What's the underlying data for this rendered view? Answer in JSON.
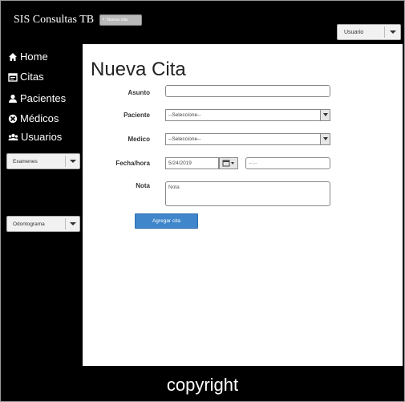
{
  "header": {
    "app_title": "SIS Consultas TB",
    "breadcrumb": "Nueva cita",
    "user_menu": "Usuario"
  },
  "sidebar": {
    "items": [
      {
        "label": "Home",
        "icon": "home-icon"
      },
      {
        "label": "Citas",
        "icon": "calendar-icon"
      },
      {
        "label": "Pacientes",
        "icon": "person-icon"
      },
      {
        "label": "Médicos",
        "icon": "stethoscope-icon"
      },
      {
        "label": "Usuarios",
        "icon": "users-icon"
      }
    ],
    "dropdowns": [
      {
        "label": "Examenes"
      },
      {
        "label": "Odontograma"
      }
    ]
  },
  "main": {
    "title": "Nueva Cita",
    "form": {
      "asunto_label": "Asunto",
      "asunto_value": "",
      "paciente_label": "Paciente",
      "paciente_value": "--Seleccione--",
      "medico_label": "Medico",
      "medico_value": "--Seleccione--",
      "fecha_label": "Fecha/hora",
      "fecha_value": "5/24/2019",
      "hora_value": "--:--",
      "nota_label": "Nota",
      "nota_placeholder": "Nota",
      "submit_label": "Agregar cita"
    }
  },
  "footer": {
    "text": "copyright"
  }
}
